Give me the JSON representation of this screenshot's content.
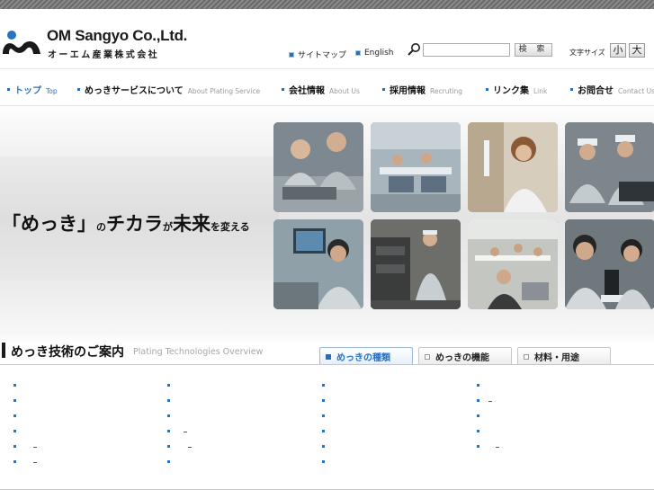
{
  "header": {
    "logo_name_en": "OM Sangyo Co.,Ltd.",
    "logo_name_jp": "オーエム産業株式会社",
    "links": [
      "サイトマップ",
      "English"
    ],
    "search": {
      "button_label": "検 索",
      "value": ""
    },
    "font_size": {
      "label": "文字サイズ",
      "small": "小",
      "large": "大"
    },
    "accent_color": "#2a72c2"
  },
  "nav": {
    "items": [
      {
        "jp": "トップ",
        "en": "Top"
      },
      {
        "jp": "めっきサービスについて",
        "en": "About Plating Service"
      },
      {
        "jp": "会社情報",
        "en": "About Us"
      },
      {
        "jp": "採用情報",
        "en": "Recruting"
      },
      {
        "jp": "リンク集",
        "en": "Link"
      },
      {
        "jp": "お問合せ",
        "en": "Contact Us"
      }
    ]
  },
  "hero": {
    "tagline": {
      "p1": "「めっき」",
      "p2": "の",
      "p3": "チカラ",
      "p4": "が",
      "p5": "未来",
      "p6": "を変える"
    }
  },
  "section": {
    "title": "めっき技術のご案内",
    "subtitle": "Plating Technologies Overview",
    "tabs": [
      "めっきの種類",
      "めっきの機能",
      "材料・用途"
    ]
  }
}
